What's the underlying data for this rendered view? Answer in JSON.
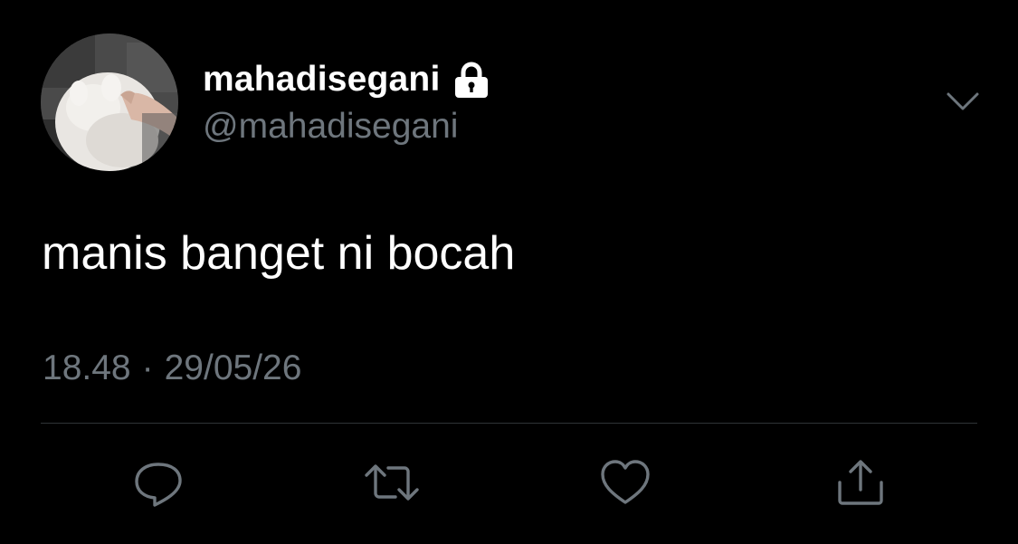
{
  "author": {
    "display_name": "mahadisegani",
    "handle": "@mahadisegani",
    "protected_icon": "lock-icon",
    "avatar": "avatar-image"
  },
  "tweet": {
    "text": "manis banget ni bocah",
    "time": "18.48",
    "separator": "·",
    "date": "29/05/26"
  },
  "actions": [
    {
      "name": "reply",
      "icon": "reply-icon"
    },
    {
      "name": "retweet",
      "icon": "retweet-icon"
    },
    {
      "name": "like",
      "icon": "heart-icon"
    },
    {
      "name": "share",
      "icon": "share-icon"
    }
  ],
  "menu": {
    "icon": "chevron-down-icon"
  },
  "colors": {
    "background": "#000000",
    "primary_text": "#ffffff",
    "secondary_text": "#6e767d",
    "divider": "#2f3336",
    "icon": "#6e767d"
  }
}
